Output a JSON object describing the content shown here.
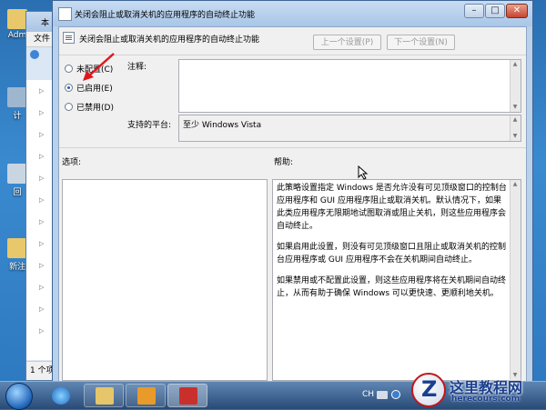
{
  "desktop": {
    "icons": [
      {
        "label": "Adm"
      },
      {
        "label": "计"
      },
      {
        "label": "回"
      },
      {
        "label": "新注"
      }
    ]
  },
  "explorer": {
    "title": "本",
    "menu_file": "文件",
    "status": "1 个项"
  },
  "dialog": {
    "title": "关闭会阻止或取消关机的应用程序的自动终止功能",
    "header_title": "关闭会阻止或取消关机的应用程序的自动终止功能",
    "prev_label": "上一个设置(P)",
    "next_label": "下一个设置(N)",
    "radios": [
      {
        "label": "未配置(C)",
        "checked": false
      },
      {
        "label": "已启用(E)",
        "checked": true
      },
      {
        "label": "已禁用(D)",
        "checked": false
      }
    ],
    "comment_label": "注释:",
    "platform_label": "支持的平台:",
    "platform_value": "至少 Windows Vista",
    "options_label": "选项:",
    "help_label": "帮助:",
    "help_paragraphs": [
      "此策略设置指定 Windows 是否允许没有可见顶级窗口的控制台应用程序和 GUI 应用程序阻止或取消关机。默认情况下，如果此类应用程序无限期地试图取消或阻止关机，则这些应用程序会自动终止。",
      "如果启用此设置，则没有可见顶级窗口且阻止或取消关机的控制台应用程序或 GUI 应用程序不会在关机期间自动终止。",
      "如果禁用或不配置此设置，则这些应用程序将在关机期间自动终止，从而有助于确保 Windows 可以更快速、更顺利地关机。"
    ]
  },
  "taskbar": {
    "tray_lang": "CH"
  },
  "watermark": {
    "brand_cn": "这里教程网",
    "brand_url": "herecours.com"
  }
}
